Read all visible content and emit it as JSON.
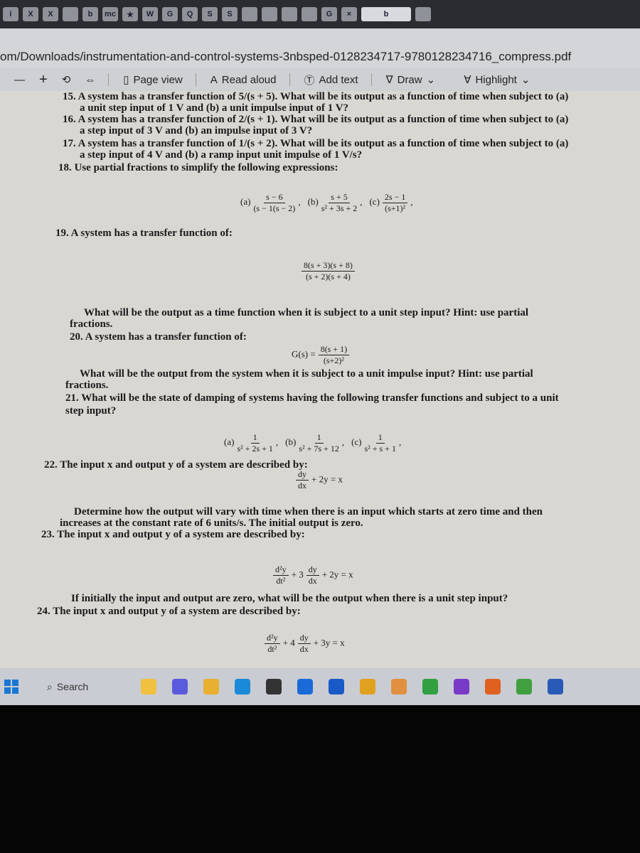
{
  "browser": {
    "tabs": [
      "i",
      "X",
      "X",
      "",
      "b",
      "mc",
      "★",
      "W",
      "G",
      "Q",
      "S",
      "S",
      "",
      "",
      "",
      "",
      "G",
      "× ",
      "b",
      ""
    ],
    "address": "om/Downloads/instrumentation-and-control-systems-3nbsped-0128234717-9780128234716_compress.pdf"
  },
  "toolbar": {
    "zoom_out": "—",
    "zoom_in": "+",
    "page_view": "Page view",
    "read_aloud": "Read aloud",
    "add_text": "Add text",
    "draw": "Draw",
    "highlight": "Highlight"
  },
  "doc": {
    "q15a": "15. A system has a transfer function of 5/(s + 5). What will be its output as a function of time when subject to (a)",
    "q15b": "a unit step input of 1 V and (b) a unit impulse input of 1 V?",
    "q16a": "16. A system has a transfer function of 2/(s + 1). What will be its output as a function of time when subject to (a)",
    "q16b": "a step input of 3 V and (b) an impulse input of 3 V?",
    "q17a": "17. A system has a transfer function of 1/(s + 2). What will be its output as a function of time when subject to (a)",
    "q17b": "a step input of 4 V and (b) a ramp input unit impulse of 1 V/s?",
    "q18": "18. Use partial fractions to simplify the following expressions:",
    "q18_exprs": [
      {
        "label": "(a)",
        "num": "s − 6",
        "den": "(s − 1(s − 2)"
      },
      {
        "label": "(b)",
        "num": "s + 5",
        "den": "s² + 3s + 2"
      },
      {
        "label": "(c)",
        "num": "2s − 1",
        "den": "(s+1)²"
      }
    ],
    "q19": "19. A system has a transfer function of:",
    "q19_num": "8(s + 3)(s + 8)",
    "q19_den": "(s + 2)(s + 4)",
    "q19b": "What will be the output as a time function when it is subject to a unit step input? Hint: use partial",
    "q19c": "fractions.",
    "q20": "20. A system has a transfer function of:",
    "q20_lhs": "G(s) =",
    "q20_num": "8(s + 1)",
    "q20_den": "(s+2)²",
    "q20b": "What will be the output from the system when it is subject to a unit impulse input? Hint: use partial",
    "q20c": "fractions.",
    "q21a": "21. What will be the state of damping of systems having the following transfer functions and subject to a unit",
    "q21b": "step input?",
    "q21_exprs": [
      {
        "label": "(a)",
        "num": "1",
        "den": "s² + 2s + 1"
      },
      {
        "label": "(b)",
        "num": "1",
        "den": "s² + 7s + 12"
      },
      {
        "label": "(c)",
        "num": "1",
        "den": "s² + s + 1"
      }
    ],
    "q22": "22. The input x and output y of a system are described by:",
    "q22_num": "dy",
    "q22_den": "dx",
    "q22_rest": "+ 2y = x",
    "q22b": "Determine how the output will vary with time when there is an input which starts at zero time and then",
    "q22c": "increases at the constant rate of 6 units/s. The initial output is zero.",
    "q23": "23. The input x and output y of a system are described by:",
    "q23_n1": "d²y",
    "q23_d1": "dt²",
    "q23_mid": "+ 3",
    "q23_n2": "dy",
    "q23_d2": "dx",
    "q23_rest": "+ 2y = x",
    "q23b": "If initially the input and output are zero, what will be the output when there is a unit step input?",
    "q24": "24. The input x and output y of a system are described by:",
    "q24_n1": "d²y",
    "q24_d1": "dt²",
    "q24_mid": "+ 4",
    "q24_n2": "dy",
    "q24_d2": "dx",
    "q24_rest": "+ 3y = x"
  },
  "taskbar": {
    "search": "Search",
    "apps": [
      "file-explorer",
      "teams",
      "folder",
      "edge",
      "store",
      "arrow",
      "mail",
      "chrome",
      "snip",
      "paint",
      "visual-studio",
      "firefox",
      "d-app",
      "word"
    ]
  }
}
